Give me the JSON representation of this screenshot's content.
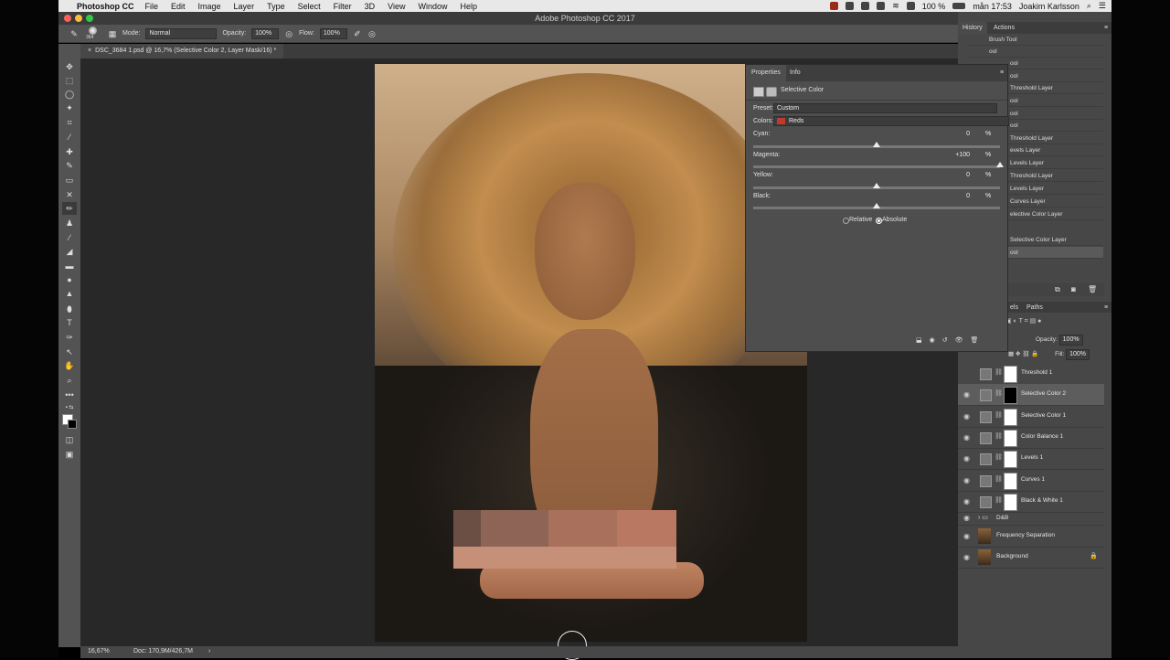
{
  "menubar": {
    "app": "Photoshop CC",
    "items": [
      "File",
      "Edit",
      "Image",
      "Layer",
      "Type",
      "Select",
      "Filter",
      "3D",
      "View",
      "Window",
      "Help"
    ],
    "battery": "100 %",
    "clock": "mån 17:53",
    "user": "Joakim Karlsson"
  },
  "window": {
    "title": "Adobe Photoshop CC 2017"
  },
  "options": {
    "brush_size": "364",
    "mode_label": "Mode:",
    "mode_value": "Normal",
    "opacity_label": "Opacity:",
    "opacity_value": "100%",
    "flow_label": "Flow:",
    "flow_value": "100%"
  },
  "document": {
    "tab": "DSC_3684 1.psd @ 16,7% (Selective Color 2, Layer Mask/16) *"
  },
  "status": {
    "zoom": "16,67%",
    "doc": "Doc: 170,9M/426,7M"
  },
  "properties": {
    "tabs": [
      "Properties",
      "Info"
    ],
    "title": "Selective Color",
    "preset_label": "Preset:",
    "preset_value": "Custom",
    "colors_label": "Colors:",
    "colors_value": "Reds",
    "colors_swatch": "#c0392b",
    "sliders": [
      {
        "label": "Cyan:",
        "value": "0",
        "pct": 0.5
      },
      {
        "label": "Magenta:",
        "value": "+100",
        "pct": 1.0
      },
      {
        "label": "Yellow:",
        "value": "0",
        "pct": 0.5
      },
      {
        "label": "Black:",
        "value": "0",
        "pct": 0.5
      }
    ],
    "unit": "%",
    "method_relative": "Relative",
    "method_absolute": "Absolute"
  },
  "history": {
    "tabs": [
      "History",
      "Actions"
    ],
    "items": [
      "Brush Tool",
      "ool",
      "ool",
      "ool",
      "Threshold Layer",
      "ool",
      "ool",
      "ool",
      "Threshold Layer",
      "evels Layer",
      "Levels Layer",
      "Threshold Layer",
      "Levels Layer",
      "Curves Layer",
      "elective Color Layer",
      "Selective Color Layer",
      "ool"
    ]
  },
  "layers": {
    "tabs": [
      "els",
      "Paths"
    ],
    "opacity_label": "Opacity:",
    "opacity_value": "100%",
    "fill_label": "Fill:",
    "fill_value": "100%",
    "rows": [
      {
        "name": "Threshold 1",
        "visible": false
      },
      {
        "name": "Selective Color 2",
        "visible": true,
        "selected": true
      },
      {
        "name": "Selective Color 1",
        "visible": true
      },
      {
        "name": "Color Balance 1",
        "visible": true
      },
      {
        "name": "Levels 1",
        "visible": true
      },
      {
        "name": "Curves 1",
        "visible": true
      },
      {
        "name": "Black & White 1",
        "visible": true
      },
      {
        "name": "D&B",
        "visible": true,
        "group": true
      },
      {
        "name": "Frequency Separation",
        "visible": true
      },
      {
        "name": "Background",
        "visible": true
      }
    ]
  }
}
